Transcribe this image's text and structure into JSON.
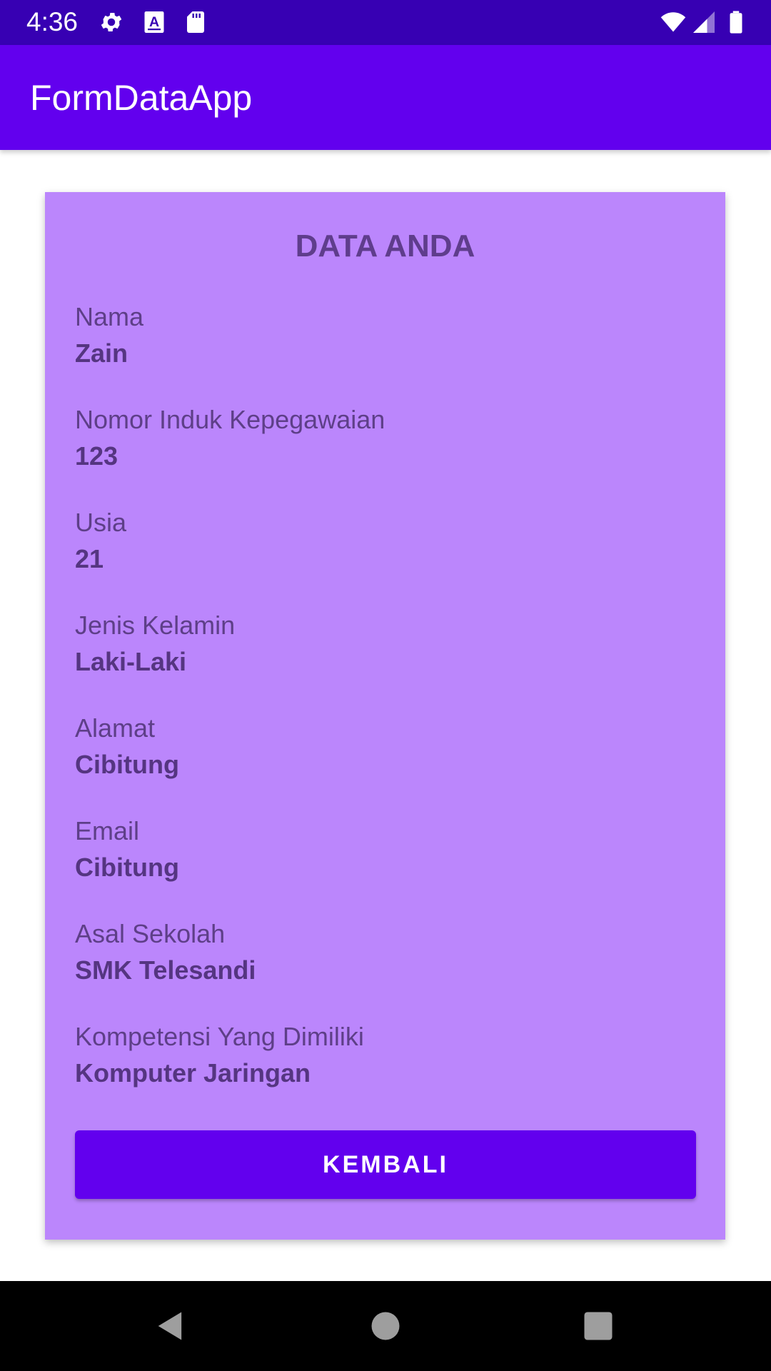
{
  "status_bar": {
    "time": "4:36",
    "left_icons": [
      "gear-icon",
      "a-accessibility-icon",
      "sd-card-icon"
    ],
    "right_icons": [
      "wifi-icon",
      "signal-icon",
      "battery-icon"
    ]
  },
  "app_bar": {
    "title": "FormDataApp",
    "color": "#6200ee"
  },
  "card": {
    "title": "DATA ANDA",
    "background": "#bb86fc",
    "fields": [
      {
        "label": "Nama",
        "value": "Zain"
      },
      {
        "label": "Nomor Induk Kepegawaian",
        "value": "123"
      },
      {
        "label": "Usia",
        "value": "21"
      },
      {
        "label": "Jenis Kelamin",
        "value": "Laki-Laki"
      },
      {
        "label": "Alamat",
        "value": "Cibitung"
      },
      {
        "label": "Email",
        "value": "Cibitung"
      },
      {
        "label": "Asal Sekolah",
        "value": "SMK Telesandi"
      },
      {
        "label": "Kompetensi Yang Dimiliki",
        "value": "Komputer Jaringan"
      }
    ],
    "button_label": "KEMBALI"
  },
  "nav_bar": {
    "icons": [
      "back-icon",
      "home-icon",
      "recents-icon"
    ]
  }
}
